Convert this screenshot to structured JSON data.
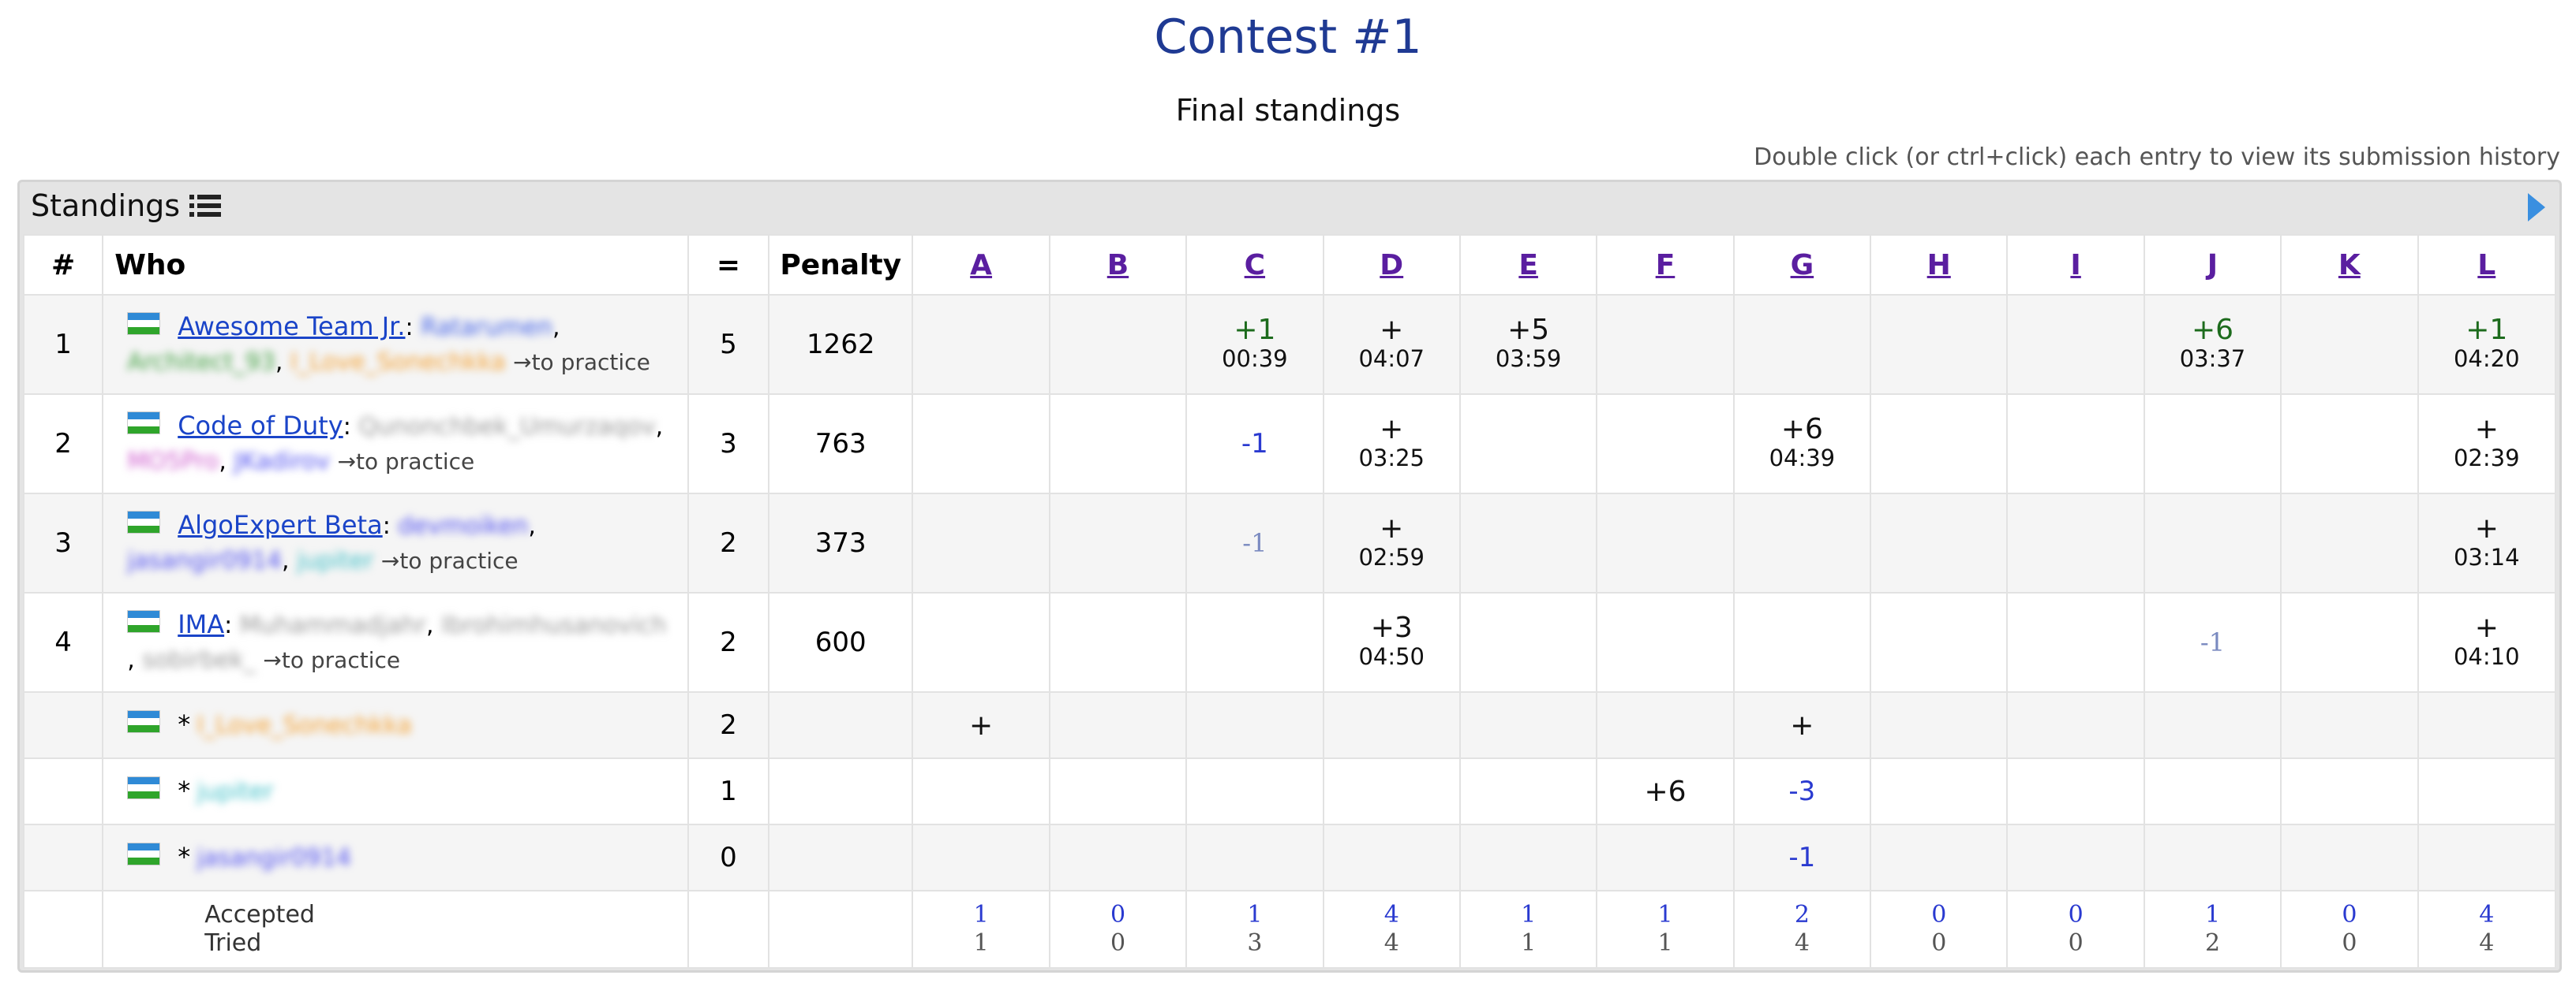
{
  "page": {
    "title": "Contest #1",
    "subtitle": "Final standings",
    "hint": "Double click (or ctrl+click) each entry to view its submission history"
  },
  "box": {
    "title": "Standings",
    "icons": {
      "list": "list-icon",
      "expand": "play-icon"
    }
  },
  "header": {
    "rank": "#",
    "who": "Who",
    "solved": "=",
    "penalty": "Penalty",
    "problems": [
      "A",
      "B",
      "C",
      "D",
      "E",
      "F",
      "G",
      "H",
      "I",
      "J",
      "K",
      "L"
    ]
  },
  "rows": [
    {
      "rank": "1",
      "team": "Awesome Team Jr.",
      "members": [
        {
          "name": "Ratarumen",
          "color": "blue",
          "sep": ","
        },
        {
          "name": "Architect_93",
          "color": "green",
          "sep": ","
        },
        {
          "name": "I_Love_Sonechkka",
          "color": "orange",
          "sep": ""
        }
      ],
      "practice": "→to practice",
      "solved": "5",
      "penalty": "1262",
      "cells": {
        "C": {
          "mark": "+1",
          "time": "00:39",
          "green": true
        },
        "D": {
          "mark": "+",
          "time": "04:07"
        },
        "E": {
          "mark": "+5",
          "time": "03:59"
        },
        "J": {
          "mark": "+6",
          "time": "03:37",
          "green": true
        },
        "L": {
          "mark": "+1",
          "time": "04:20",
          "green": true
        }
      }
    },
    {
      "rank": "2",
      "team": "Code of Duty",
      "members": [
        {
          "name": "Qunonchbek_Umurzaqov",
          "color": "gray",
          "sep": ","
        },
        {
          "name": "MO5Pro",
          "color": "pink",
          "sep": ","
        },
        {
          "name": "JKadirov",
          "color": "violet",
          "sep": ""
        }
      ],
      "practice": "→to practice",
      "solved": "3",
      "penalty": "763",
      "cells": {
        "C": {
          "fail": "-1"
        },
        "D": {
          "mark": "+",
          "time": "03:25"
        },
        "G": {
          "mark": "+6",
          "time": "04:39"
        },
        "L": {
          "mark": "+",
          "time": "02:39"
        }
      }
    },
    {
      "rank": "3",
      "team": "AlgoExpert Beta",
      "members": [
        {
          "name": "devmoiken",
          "color": "violet",
          "sep": ","
        },
        {
          "name": "jasangir0914",
          "color": "violet",
          "sep": ","
        },
        {
          "name": "jupiter",
          "color": "teal",
          "sep": ""
        }
      ],
      "practice": "→to practice",
      "solved": "2",
      "penalty": "373",
      "cells": {
        "C": {
          "fail": "-1",
          "faint": true
        },
        "D": {
          "mark": "+",
          "time": "02:59"
        },
        "L": {
          "mark": "+",
          "time": "03:14"
        }
      }
    },
    {
      "rank": "4",
      "team": "IMA",
      "members": [
        {
          "name": "Muhammadjahr",
          "color": "gray",
          "sep": ","
        },
        {
          "name": "Ibrohimhusanovich",
          "color": "gray",
          "sep": ""
        },
        {
          "name": "sobirbek_",
          "color": "gray",
          "sep": "",
          "lead": ", "
        }
      ],
      "practice": "→to practice",
      "solved": "2",
      "penalty": "600",
      "cells": {
        "D": {
          "mark": "+3",
          "time": "04:50"
        },
        "J": {
          "fail": "-1",
          "faint": true
        },
        "L": {
          "mark": "+",
          "time": "04:10"
        }
      }
    }
  ],
  "virtual_rows": [
    {
      "name": "I_Love_Sonechkka",
      "color": "orange",
      "solved": "2",
      "cells": {
        "A": {
          "plus": "+"
        },
        "G": {
          "plus": "+"
        }
      }
    },
    {
      "name": "jupiter",
      "color": "teal",
      "solved": "1",
      "cells": {
        "F": {
          "plus": "+6"
        },
        "G": {
          "fail": "-3"
        }
      }
    },
    {
      "name": "jasangir0914",
      "color": "violet",
      "solved": "0",
      "cells": {
        "G": {
          "fail": "-1"
        }
      }
    }
  ],
  "summary": {
    "accepted_label": "Accepted",
    "tried_label": "Tried",
    "accepted": [
      "1",
      "0",
      "1",
      "4",
      "1",
      "1",
      "2",
      "0",
      "0",
      "1",
      "0",
      "4"
    ],
    "tried": [
      "1",
      "0",
      "3",
      "4",
      "1",
      "1",
      "4",
      "0",
      "0",
      "2",
      "0",
      "4"
    ]
  },
  "colors": {
    "title": "#1f3a93",
    "link": "#1a44c8",
    "problem_link": "#5a1ea0",
    "accepted_green": "#1d6b1d",
    "fail_blue": "#2a3ad0"
  }
}
